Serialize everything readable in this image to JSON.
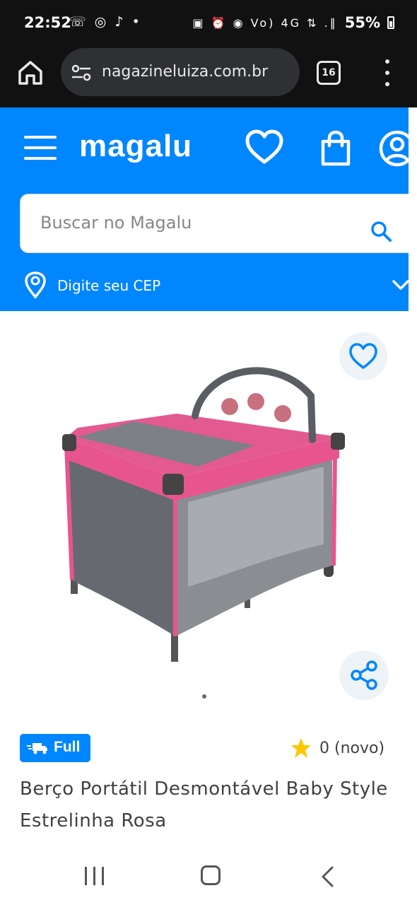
{
  "status_bar": {
    "time": "22:52",
    "apps": "☏ ◎ ♪ •",
    "icons": "▣ ⏰ ◉ Vo) 4G ⇅ .∥",
    "battery": "55%"
  },
  "browser": {
    "url": "nagazineluiza.com.br",
    "tab_count": "16"
  },
  "header": {
    "logo": "magalu",
    "search_placeholder": "Buscar no Magalu",
    "cep_label": "Digite seu CEP"
  },
  "product": {
    "badge": "Full",
    "rating": "0 (novo)",
    "title": "Berço Portátil Desmontável Baby Style Estrelinha Rosa"
  },
  "colors": {
    "brand_blue": "#0086ff",
    "star": "#ffc700",
    "crib_pink": "#e8558e",
    "crib_gray": "#666a70"
  }
}
